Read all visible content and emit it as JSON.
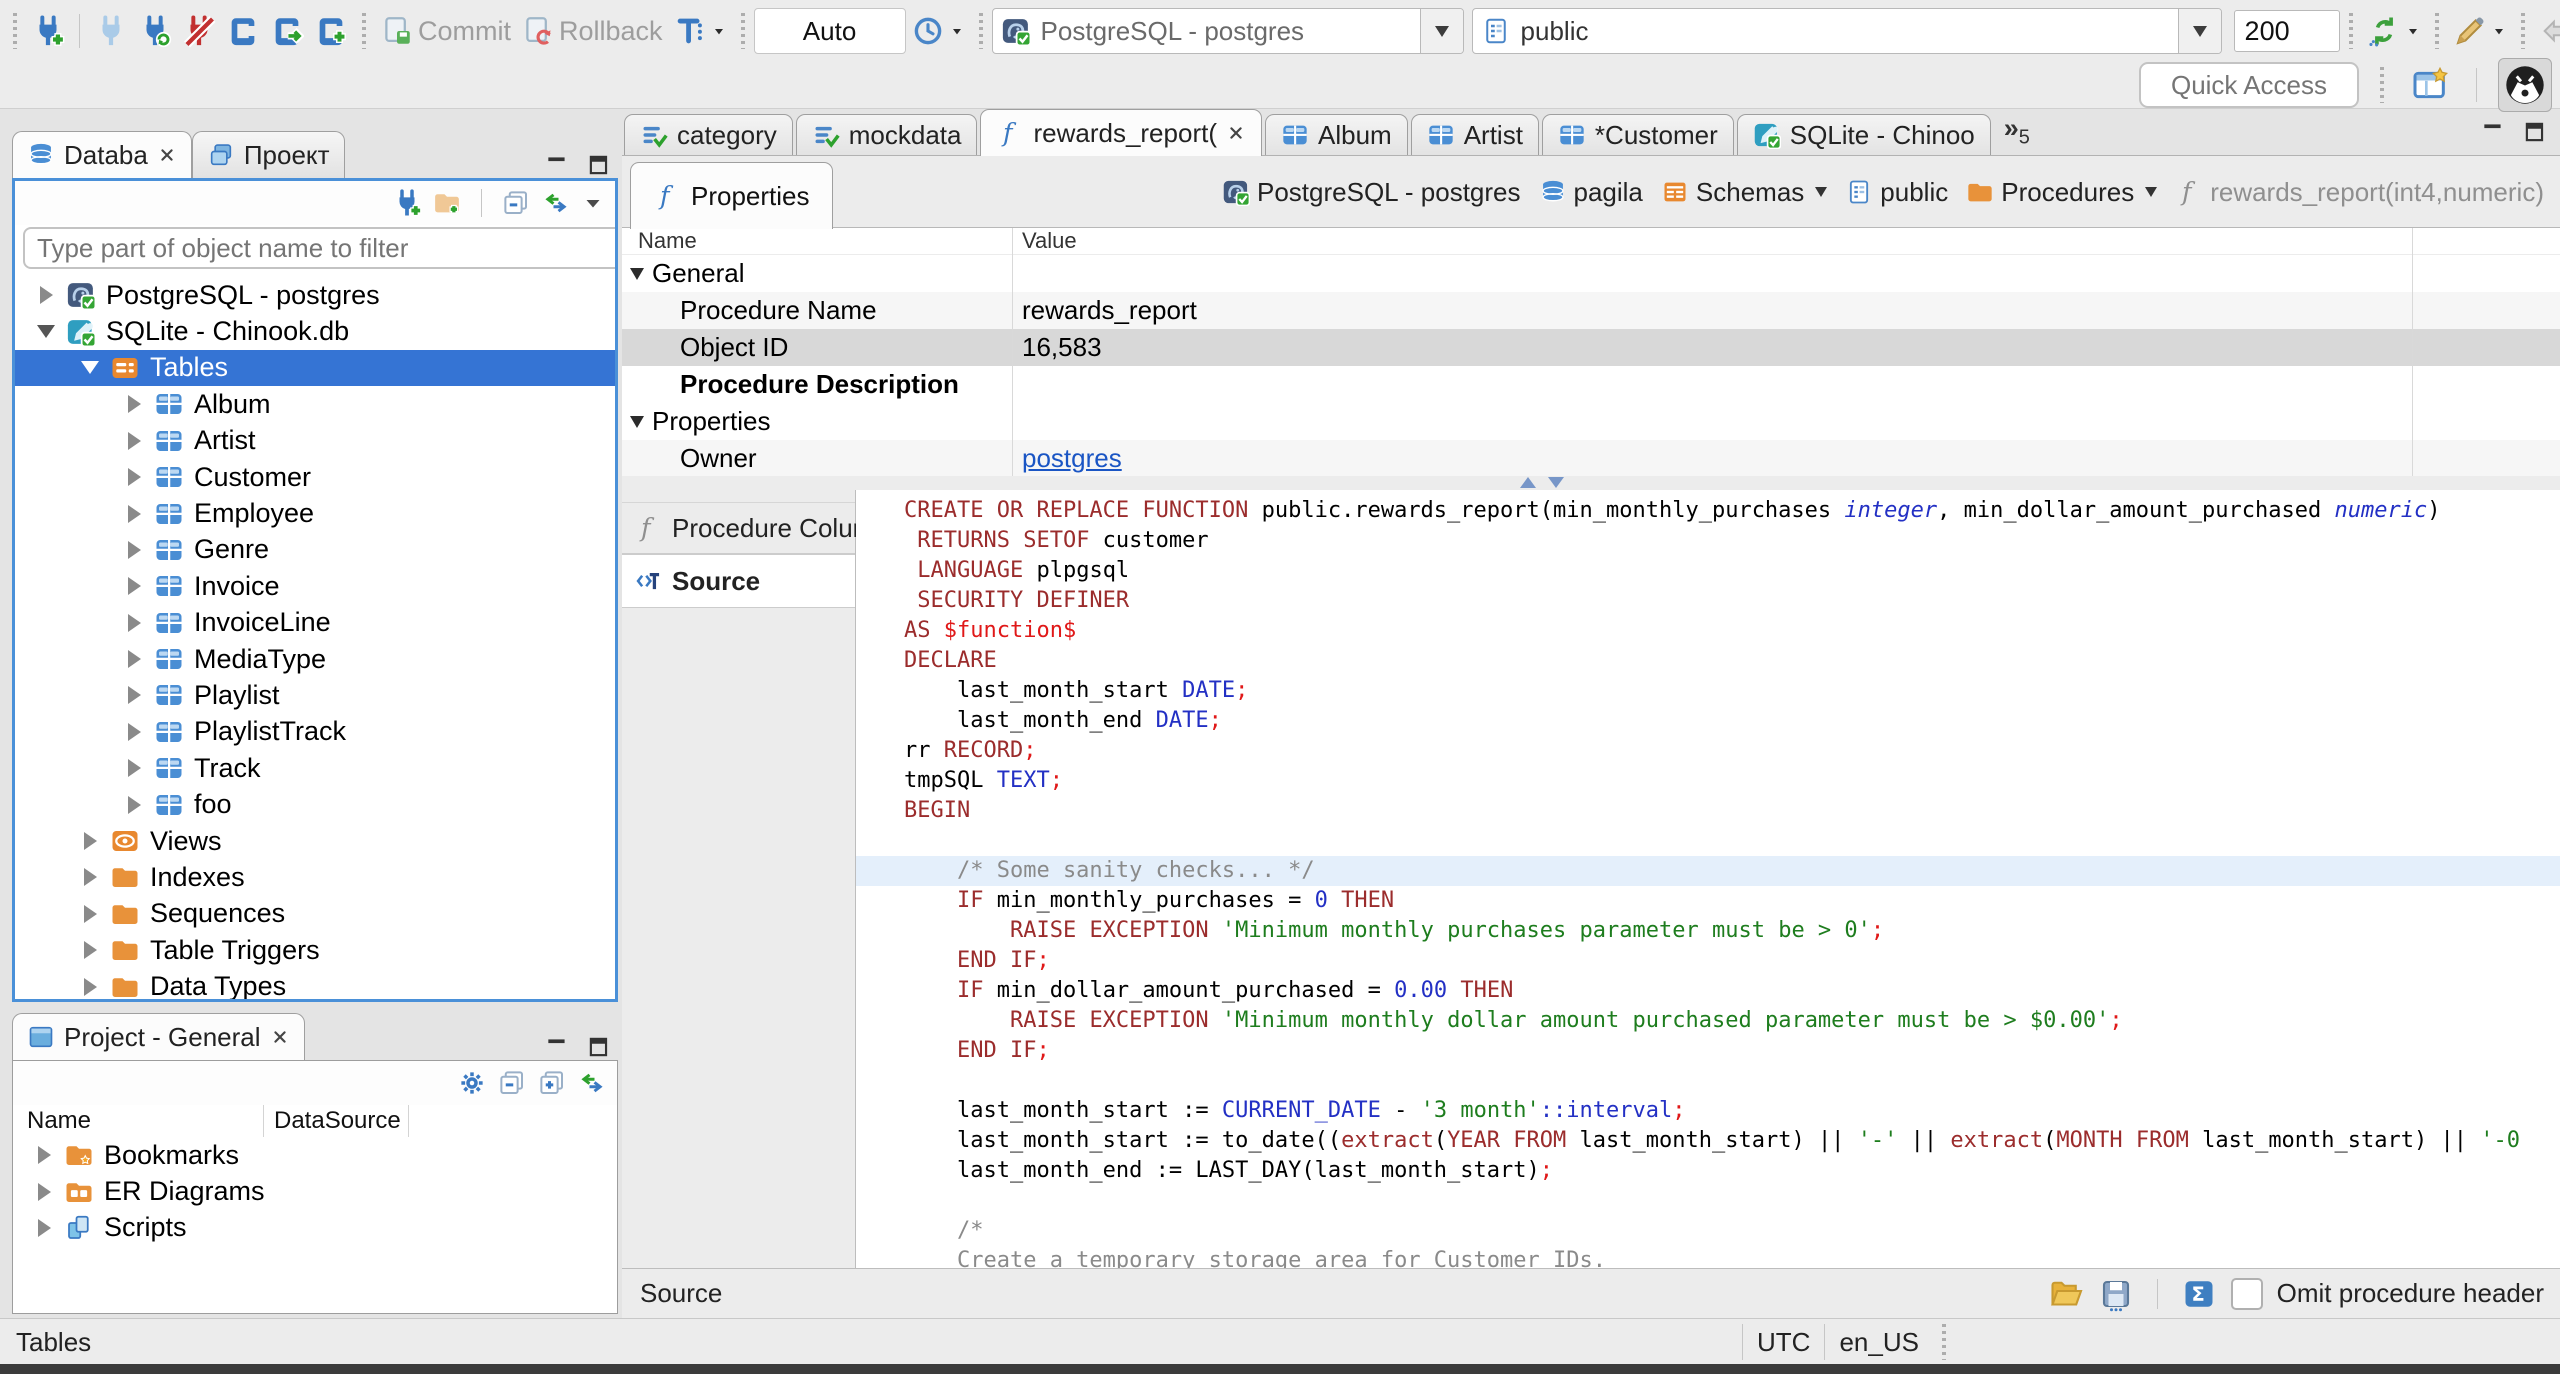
{
  "toolbar": {
    "commit": "Commit",
    "rollback": "Rollback",
    "auto": "Auto",
    "connection": "PostgreSQL - postgres",
    "schema": "public",
    "fetch_size": "200",
    "quick_access": "Quick Access"
  },
  "sidebar": {
    "tabs": [
      {
        "label": "Databa"
      },
      {
        "label": "Проект"
      }
    ],
    "filter_placeholder": "Type part of object name to filter",
    "tree": [
      {
        "icon": "postgres",
        "label": "PostgreSQL - postgres",
        "depth": 0,
        "expand": "collapsed"
      },
      {
        "icon": "sqlite",
        "label": "SQLite - Chinook.db",
        "depth": 0,
        "expand": "expanded"
      },
      {
        "icon": "tables",
        "label": "Tables",
        "depth": 1,
        "expand": "expanded",
        "selected": true
      },
      {
        "icon": "table",
        "label": "Album",
        "depth": 2,
        "expand": "collapsed"
      },
      {
        "icon": "table",
        "label": "Artist",
        "depth": 2,
        "expand": "collapsed"
      },
      {
        "icon": "table",
        "label": "Customer",
        "depth": 2,
        "expand": "collapsed"
      },
      {
        "icon": "table",
        "label": "Employee",
        "depth": 2,
        "expand": "collapsed"
      },
      {
        "icon": "table",
        "label": "Genre",
        "depth": 2,
        "expand": "collapsed"
      },
      {
        "icon": "table",
        "label": "Invoice",
        "depth": 2,
        "expand": "collapsed"
      },
      {
        "icon": "table",
        "label": "InvoiceLine",
        "depth": 2,
        "expand": "collapsed"
      },
      {
        "icon": "table",
        "label": "MediaType",
        "depth": 2,
        "expand": "collapsed"
      },
      {
        "icon": "table",
        "label": "Playlist",
        "depth": 2,
        "expand": "collapsed"
      },
      {
        "icon": "table",
        "label": "PlaylistTrack",
        "depth": 2,
        "expand": "collapsed"
      },
      {
        "icon": "table",
        "label": "Track",
        "depth": 2,
        "expand": "collapsed"
      },
      {
        "icon": "table",
        "label": "foo",
        "depth": 2,
        "expand": "collapsed"
      },
      {
        "icon": "views",
        "label": "Views",
        "depth": 1,
        "expand": "collapsed"
      },
      {
        "icon": "folder",
        "label": "Indexes",
        "depth": 1,
        "expand": "collapsed"
      },
      {
        "icon": "folder",
        "label": "Sequences",
        "depth": 1,
        "expand": "collapsed"
      },
      {
        "icon": "folder",
        "label": "Table Triggers",
        "depth": 1,
        "expand": "collapsed"
      },
      {
        "icon": "folder",
        "label": "Data Types",
        "depth": 1,
        "expand": "collapsed"
      }
    ]
  },
  "project_panel": {
    "title": "Project - General",
    "columns": [
      "Name",
      "DataSource"
    ],
    "items": [
      {
        "icon": "folder-star",
        "label": "Bookmarks"
      },
      {
        "icon": "folder-er",
        "label": "ER Diagrams"
      },
      {
        "icon": "scripts",
        "label": "Scripts"
      }
    ]
  },
  "status_bar": {
    "left": "Tables",
    "timezone": "UTC",
    "locale": "en_US"
  },
  "editor": {
    "tabs": [
      {
        "icon": "sqlfile",
        "label": "category"
      },
      {
        "icon": "sqlfile",
        "label": "mockdata"
      },
      {
        "icon": "func",
        "label": "rewards_report(",
        "active": true,
        "closable": true
      },
      {
        "icon": "table",
        "label": "Album"
      },
      {
        "icon": "table",
        "label": "Artist"
      },
      {
        "icon": "table",
        "label": "*Customer"
      },
      {
        "icon": "sqlite",
        "label": "SQLite - Chinoo"
      }
    ],
    "hidden_tabs_count": "5",
    "properties_tab": "Properties",
    "breadcrumb": [
      {
        "icon": "postgres",
        "label": "PostgreSQL - postgres"
      },
      {
        "icon": "database",
        "label": "pagila"
      },
      {
        "icon": "schemas",
        "label": "Schemas",
        "dropdown": true
      },
      {
        "icon": "page",
        "label": "public"
      },
      {
        "icon": "folder",
        "label": "Procedures",
        "dropdown": true
      },
      {
        "icon": "func-gray",
        "label": "rewards_report(int4,numeric)",
        "muted": true
      }
    ],
    "grid": {
      "columns": [
        "Name",
        "Value"
      ],
      "rows": [
        {
          "type": "group",
          "name": "General",
          "value": ""
        },
        {
          "name": "Procedure Name",
          "value": "rewards_report",
          "shade": true
        },
        {
          "name": "Object ID",
          "value": "16,583",
          "selected": true
        },
        {
          "name": "Procedure Description",
          "value": "",
          "bold": true
        },
        {
          "type": "group",
          "name": "Properties",
          "value": ""
        },
        {
          "name": "Owner",
          "value": "postgres",
          "link": true,
          "shade": true
        }
      ]
    },
    "subtabs": [
      {
        "icon": "func-gray",
        "label": "Procedure Columns"
      },
      {
        "icon": "source",
        "label": "Source",
        "active": true
      }
    ],
    "footer": {
      "label": "Source",
      "checkbox_label": "Omit procedure header",
      "checkbox_checked": false
    },
    "code_lines": [
      {
        "seg": [
          [
            "kw",
            "CREATE OR REPLACE FUNCTION"
          ],
          [
            "pl",
            " public.rewards_report(min_monthly_purchases "
          ],
          [
            "tyi",
            "integer"
          ],
          [
            "pl",
            ", min_dollar_amount_purchased "
          ],
          [
            "tyi",
            "numeric"
          ],
          [
            "pl",
            ")"
          ]
        ]
      },
      {
        "seg": [
          [
            "pl",
            " "
          ],
          [
            "kw",
            "RETURNS SETOF"
          ],
          [
            "pl",
            " customer"
          ]
        ]
      },
      {
        "seg": [
          [
            "pl",
            " "
          ],
          [
            "kw",
            "LANGUAGE"
          ],
          [
            "pl",
            " plpgsql"
          ]
        ]
      },
      {
        "seg": [
          [
            "pl",
            " "
          ],
          [
            "kw",
            "SECURITY DEFINER"
          ]
        ]
      },
      {
        "seg": [
          [
            "kw",
            "AS"
          ],
          [
            "pl",
            " "
          ],
          [
            "dl",
            "$function$"
          ]
        ]
      },
      {
        "seg": [
          [
            "kw",
            "DECLARE"
          ]
        ]
      },
      {
        "seg": [
          [
            "pl",
            "    last_month_start "
          ],
          [
            "ty",
            "DATE"
          ],
          [
            "sm",
            ";"
          ]
        ]
      },
      {
        "seg": [
          [
            "pl",
            "    last_month_end "
          ],
          [
            "ty",
            "DATE"
          ],
          [
            "sm",
            ";"
          ]
        ]
      },
      {
        "seg": [
          [
            "pl",
            "rr "
          ],
          [
            "kw",
            "RECORD"
          ],
          [
            "sm",
            ";"
          ]
        ]
      },
      {
        "seg": [
          [
            "pl",
            "tmpSQL "
          ],
          [
            "ty",
            "TEXT"
          ],
          [
            "sm",
            ";"
          ]
        ]
      },
      {
        "seg": [
          [
            "kw",
            "BEGIN"
          ]
        ]
      },
      {
        "seg": []
      },
      {
        "hl": true,
        "seg": [
          [
            "cm",
            "    /* Some sanity checks... */"
          ]
        ]
      },
      {
        "seg": [
          [
            "pl",
            "    "
          ],
          [
            "kw",
            "IF"
          ],
          [
            "pl",
            " min_monthly_purchases = "
          ],
          [
            "nm",
            "0"
          ],
          [
            "pl",
            " "
          ],
          [
            "kw",
            "THEN"
          ]
        ]
      },
      {
        "seg": [
          [
            "pl",
            "        "
          ],
          [
            "kw",
            "RAISE EXCEPTION"
          ],
          [
            "pl",
            " "
          ],
          [
            "st",
            "'Minimum monthly purchases parameter must be > 0'"
          ],
          [
            "sm",
            ";"
          ]
        ]
      },
      {
        "seg": [
          [
            "pl",
            "    "
          ],
          [
            "kw",
            "END IF"
          ],
          [
            "sm",
            ";"
          ]
        ]
      },
      {
        "seg": [
          [
            "pl",
            "    "
          ],
          [
            "kw",
            "IF"
          ],
          [
            "pl",
            " min_dollar_amount_purchased = "
          ],
          [
            "nm",
            "0.00"
          ],
          [
            "pl",
            " "
          ],
          [
            "kw",
            "THEN"
          ]
        ]
      },
      {
        "seg": [
          [
            "pl",
            "        "
          ],
          [
            "kw",
            "RAISE EXCEPTION"
          ],
          [
            "pl",
            " "
          ],
          [
            "st",
            "'Minimum monthly dollar amount purchased parameter must be > $0.00'"
          ],
          [
            "sm",
            ";"
          ]
        ]
      },
      {
        "seg": [
          [
            "pl",
            "    "
          ],
          [
            "kw",
            "END IF"
          ],
          [
            "sm",
            ";"
          ]
        ]
      },
      {
        "seg": []
      },
      {
        "seg": [
          [
            "pl",
            "    last_month_start := "
          ],
          [
            "ty",
            "CURRENT_DATE"
          ],
          [
            "pl",
            " - "
          ],
          [
            "st",
            "'3 month'"
          ],
          [
            "ty",
            "::interval"
          ],
          [
            "sm",
            ";"
          ]
        ]
      },
      {
        "seg": [
          [
            "pl",
            "    last_month_start := to_date(("
          ],
          [
            "kw",
            "extract"
          ],
          [
            "pl",
            "("
          ],
          [
            "kw",
            "YEAR FROM"
          ],
          [
            "pl",
            " last_month_start) || "
          ],
          [
            "st",
            "'-'"
          ],
          [
            "pl",
            " || "
          ],
          [
            "kw",
            "extract"
          ],
          [
            "pl",
            "("
          ],
          [
            "kw",
            "MONTH FROM"
          ],
          [
            "pl",
            " last_month_start) || "
          ],
          [
            "st",
            "'-0"
          ]
        ]
      },
      {
        "seg": [
          [
            "pl",
            "    last_month_end := LAST_DAY(last_month_start)"
          ],
          [
            "sm",
            ";"
          ]
        ]
      },
      {
        "seg": []
      },
      {
        "seg": [
          [
            "cm",
            "    /*"
          ]
        ]
      },
      {
        "seg": [
          [
            "cm",
            "    Create a temporary storage area for Customer IDs."
          ]
        ]
      },
      {
        "seg": [
          [
            "cm",
            "    */"
          ]
        ]
      }
    ]
  }
}
